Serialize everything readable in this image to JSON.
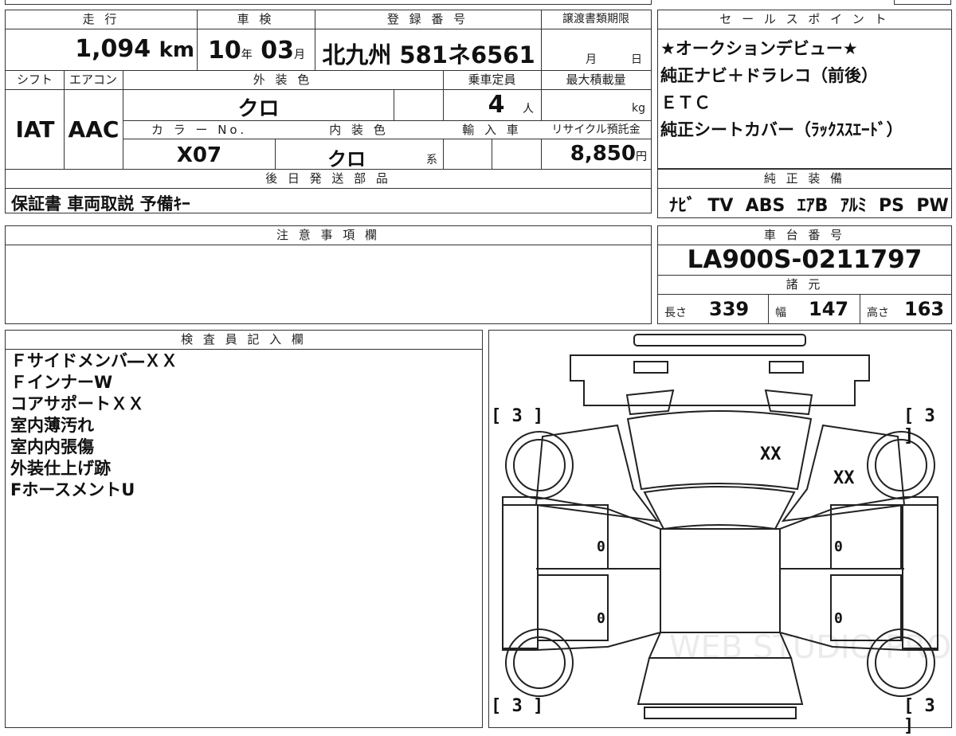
{
  "top": {
    "mileage_label": "走 行",
    "mileage_value": "1,094",
    "mileage_unit": "km",
    "inspection_label": "車 検",
    "inspection_year": "10",
    "inspection_year_unit": "年",
    "inspection_month": "03",
    "inspection_month_unit": "月",
    "reg_label": "登 録 番 号",
    "reg_value": "北九州 581ネ6561",
    "transfer_label": "譲渡書類期限",
    "transfer_month": "月",
    "transfer_day": "日",
    "shift_label": "シフト",
    "shift_value": "IAT",
    "ac_label": "エアコン",
    "ac_value": "AAC",
    "exterior_label": "外 装 色",
    "exterior_value": "クロ",
    "capacity_label": "乗車定員",
    "capacity_value": "4",
    "capacity_unit": "人",
    "maxload_label": "最大積載量",
    "maxload_unit": "kg",
    "colorno_label": "カ ラ ー No.",
    "colorno_value": "X07",
    "interior_label": "内 装 色",
    "interior_value": "クロ",
    "interior_suffix": "系",
    "import_label": "輸 入 車",
    "recycle_label": "リサイクル預託金",
    "recycle_value": "8,850",
    "recycle_unit": "円",
    "parts_label": "後 日 発 送 部 品",
    "parts_value": "保証書 車両取説 予備ｷｰ"
  },
  "sales": {
    "header": "セ ー ル ス ポ イ ン ト",
    "lines": [
      "★オークションデビュー★",
      "純正ナビ＋ドラレコ（前後）",
      "ＥＴＣ",
      "純正シートカバー（ﾗｯｸｽｽｴｰﾄﾞ）"
    ]
  },
  "equipment": {
    "header": "純 正 装 備",
    "value": "ﾅﾋﾞ  TV  ABS  ｴｱB  ｱﾙﾐ  PS  PW"
  },
  "caution": {
    "header": "注 意 事 項 欄"
  },
  "chassis": {
    "header": "車 台 番 号",
    "value": "LA900S-0211797"
  },
  "specs": {
    "header": "諸 元",
    "length_label": "長さ",
    "length_value": "339",
    "width_label": "幅",
    "width_value": "147",
    "height_label": "高さ",
    "height_value": "163"
  },
  "inspector": {
    "header": "検 査 員 記 入 欄",
    "notes": [
      "Ｆサイドメンバ―ＸＸ",
      "ＦインナーW",
      "コアサポートＸＸ",
      "室内薄汚れ",
      "室内内張傷",
      "外装仕上げ跡",
      "FホースメントU"
    ]
  },
  "diagram": {
    "tire_front_left": "[ 3 ]",
    "tire_front_right": "[ 3 ]",
    "tire_rear_left": "[ 3 ]",
    "tire_rear_right": "[ 3 ]",
    "mark_hood": "XX",
    "mark_fender": "XX",
    "mark_door_left_front": "0",
    "mark_door_right_front": "0",
    "mark_door_left_rear": "0",
    "mark_door_right_rear": "0",
    "watermark": "WEB STUDIO PRO"
  }
}
